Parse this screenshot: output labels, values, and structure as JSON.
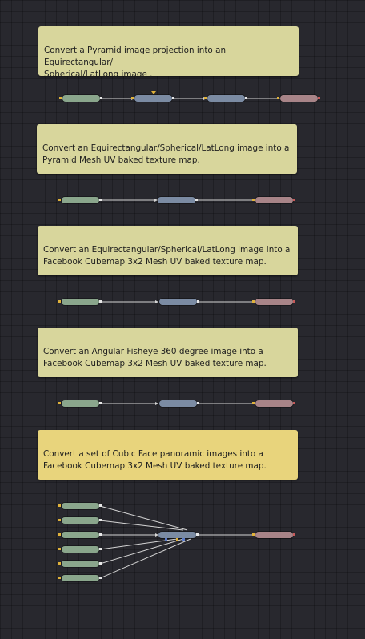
{
  "notes": [
    {
      "text": "Convert a Pyramid image projection into an Equirectangular/\nSpherical/LatLong image ."
    },
    {
      "text": "Convert an Equirectangular/Spherical/LatLong image into a\nPyramid Mesh UV baked texture map."
    },
    {
      "text": "Convert an Equirectangular/Spherical/LatLong image into a\nFacebook Cubemap 3x2 Mesh UV baked texture map."
    },
    {
      "text": "Convert an Angular Fisheye 360 degree image into a\nFacebook Cubemap 3x2 Mesh UV baked texture map."
    },
    {
      "text": "Convert a set of Cubic Face panoramic images into a\nFacebook Cubemap 3x2 Mesh UV baked texture map."
    }
  ],
  "colors": {
    "background": "#28282e",
    "note": "#d8d69c",
    "note_selected": "#e8d47c",
    "loader_node": "#8aa68c",
    "tool_node": "#7b8ba3",
    "saver_node": "#a88488",
    "wire": "#d4d4d4",
    "input_port": "#e0b23a"
  }
}
